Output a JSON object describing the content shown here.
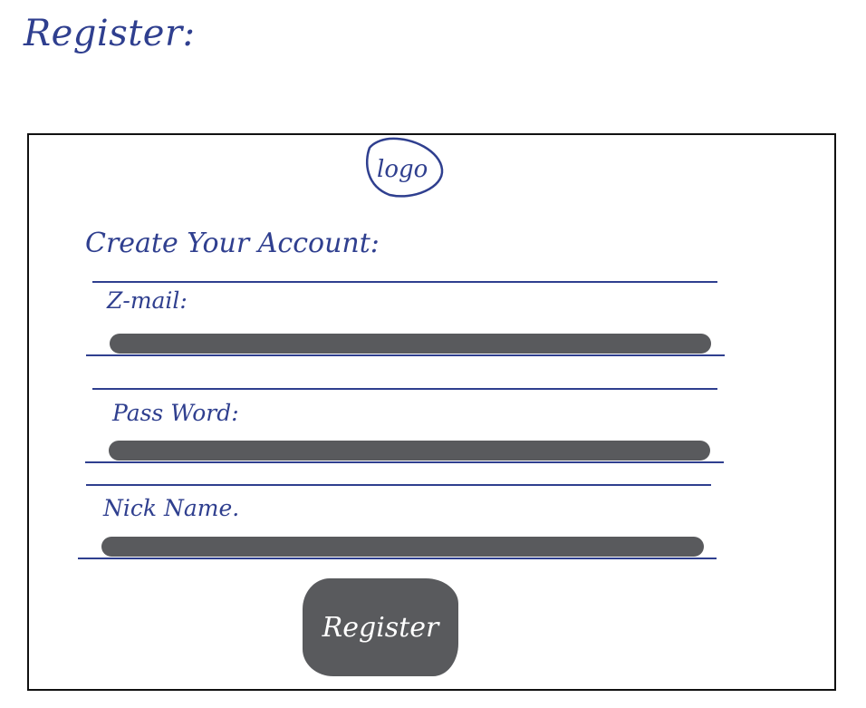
{
  "page": {
    "heading": "Register:"
  },
  "card": {
    "logo_text": "logo",
    "title": "Create Your Account:"
  },
  "fields": {
    "email_label": "Z-mail:",
    "password_label": "Pass Word:",
    "nickname_label": "Nick Name."
  },
  "actions": {
    "register_label": "Register"
  },
  "colors": {
    "ink": "#2f3f8f",
    "input_fill": "#595a5d",
    "button_fill": "#595a5d",
    "frame_border": "#111111"
  }
}
